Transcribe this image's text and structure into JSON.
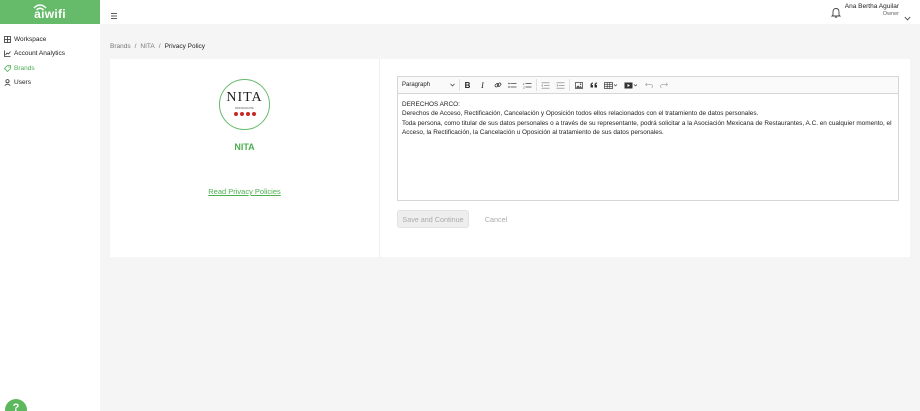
{
  "app": {
    "logo_text": "aiwifi"
  },
  "sidebar": {
    "items": [
      {
        "label": "Workspace",
        "icon": "grid-icon"
      },
      {
        "label": "Account Analytics",
        "icon": "chart-icon"
      },
      {
        "label": "Brands",
        "icon": "tag-icon",
        "active": true
      },
      {
        "label": "Users",
        "icon": "user-icon"
      }
    ],
    "help_label": "?"
  },
  "topbar": {
    "user_name": "Ana Bertha Aguilar",
    "user_role": "Owner"
  },
  "breadcrumb": {
    "items": [
      "Brands",
      "NITA",
      "Privacy Policy"
    ],
    "separator": "/"
  },
  "brand": {
    "logo_word": "NITA",
    "logo_sub": "RESTAURANTE",
    "name": "NITA",
    "read_link": "Read Privacy Policies"
  },
  "editor": {
    "block_format": "Paragraph",
    "content": [
      "DERECHOS ARCO:",
      "Derechos de Acceso, Rectificación, Cancelación y Oposición todos ellos relacionados con el tratamiento de datos personales.",
      "Toda persona, como titular de sus datos personales o a través de su representante, podrá solicitar a la Asociación Mexicana de Restaurantes, A.C. en cualquier momento, el Acceso, la Rectificación, la Cancelación u   Oposición al tratamiento de sus datos personales."
    ]
  },
  "actions": {
    "save_label": "Save and Continue",
    "cancel_label": "Cancel"
  },
  "colors": {
    "brand_green": "#66bb6a",
    "link_green": "#4caf50",
    "logo_red": "#c62828"
  }
}
